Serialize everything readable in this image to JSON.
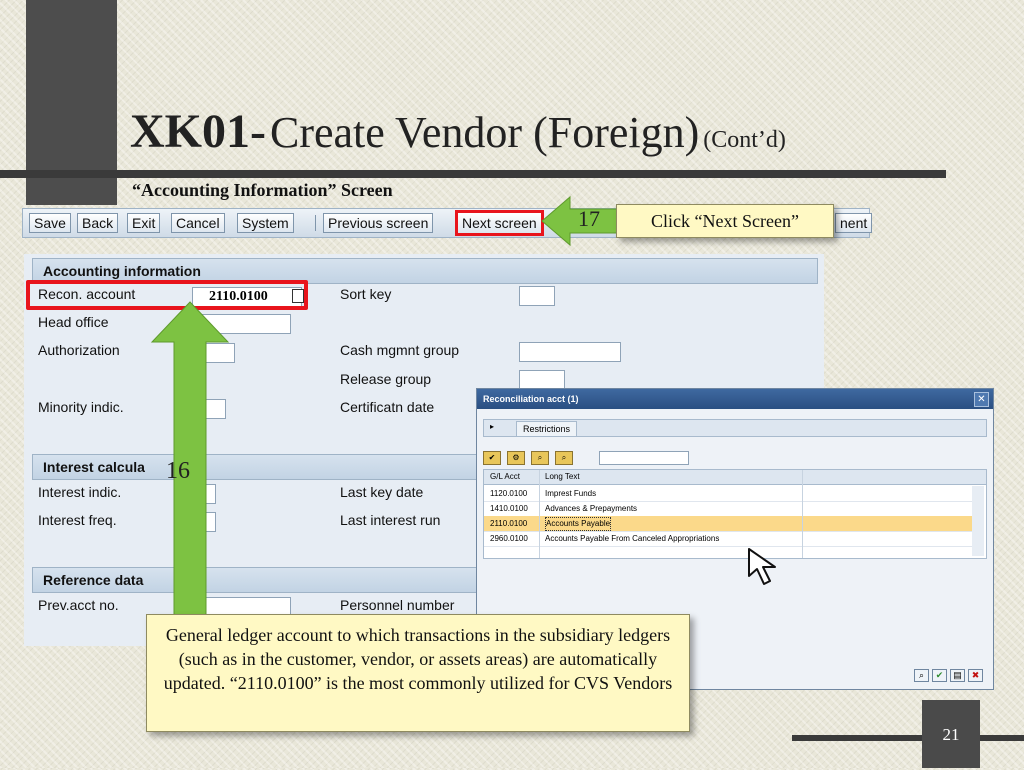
{
  "title": {
    "code": "XK01-",
    "main": "Create Vendor (Foreign)",
    "suffix": "(Cont’d)"
  },
  "subtitle": "“Accounting Information” Screen",
  "toolbar": {
    "save": "Save",
    "back": "Back",
    "exit": "Exit",
    "cancel": "Cancel",
    "system": "System",
    "previous": "Previous screen",
    "next": "Next screen",
    "trailing": "nent"
  },
  "form": {
    "accounting_header": "Accounting information",
    "recon_label": "Recon. account",
    "recon_value": "2110.0100",
    "sort_key": "Sort key",
    "head_office": "Head office",
    "authorization": "Authorization",
    "cash_group": "Cash mgmnt group",
    "release_group": "Release group",
    "minority": "Minority indic.",
    "certificate_date": "Certificatn date",
    "interest_header": "Interest calcula",
    "interest_indic": "Interest indic.",
    "last_key_date": "Last key date",
    "interest_freq": "Interest freq.",
    "last_interest_run": "Last interest run",
    "reference_header": "Reference data",
    "prev_acct": "Prev.acct no.",
    "personnel_number": "Personnel number"
  },
  "popup": {
    "title": "Reconciliation acct (1)",
    "restrictions": "Restrictions",
    "col_gl": "G/L Acct",
    "col_text": "Long Text",
    "rows": [
      {
        "gl": "1120.0100",
        "text": "Imprest Funds"
      },
      {
        "gl": "1410.0100",
        "text": "Advances & Prepayments"
      },
      {
        "gl": "2110.0100",
        "text": "Accounts Payable"
      },
      {
        "gl": "2960.0100",
        "text": "Accounts Payable From Canceled Appropriations"
      }
    ],
    "selected_row": 2
  },
  "callouts": {
    "step17": "17",
    "click_next": "Click “Next Screen”",
    "step16": "16",
    "explanation": "General ledger account to which transactions in the subsidiary ledgers (such as in the customer, vendor, or assets areas) are automatically updated.  “2110.0100” is the most commonly utilized for CVS Vendors"
  },
  "slide_number": "21",
  "colors": {
    "highlight_red": "#e8141c",
    "arrow_green": "#7dc242",
    "callout_bg": "#fff9c4",
    "selected_row": "#fbd98a"
  }
}
